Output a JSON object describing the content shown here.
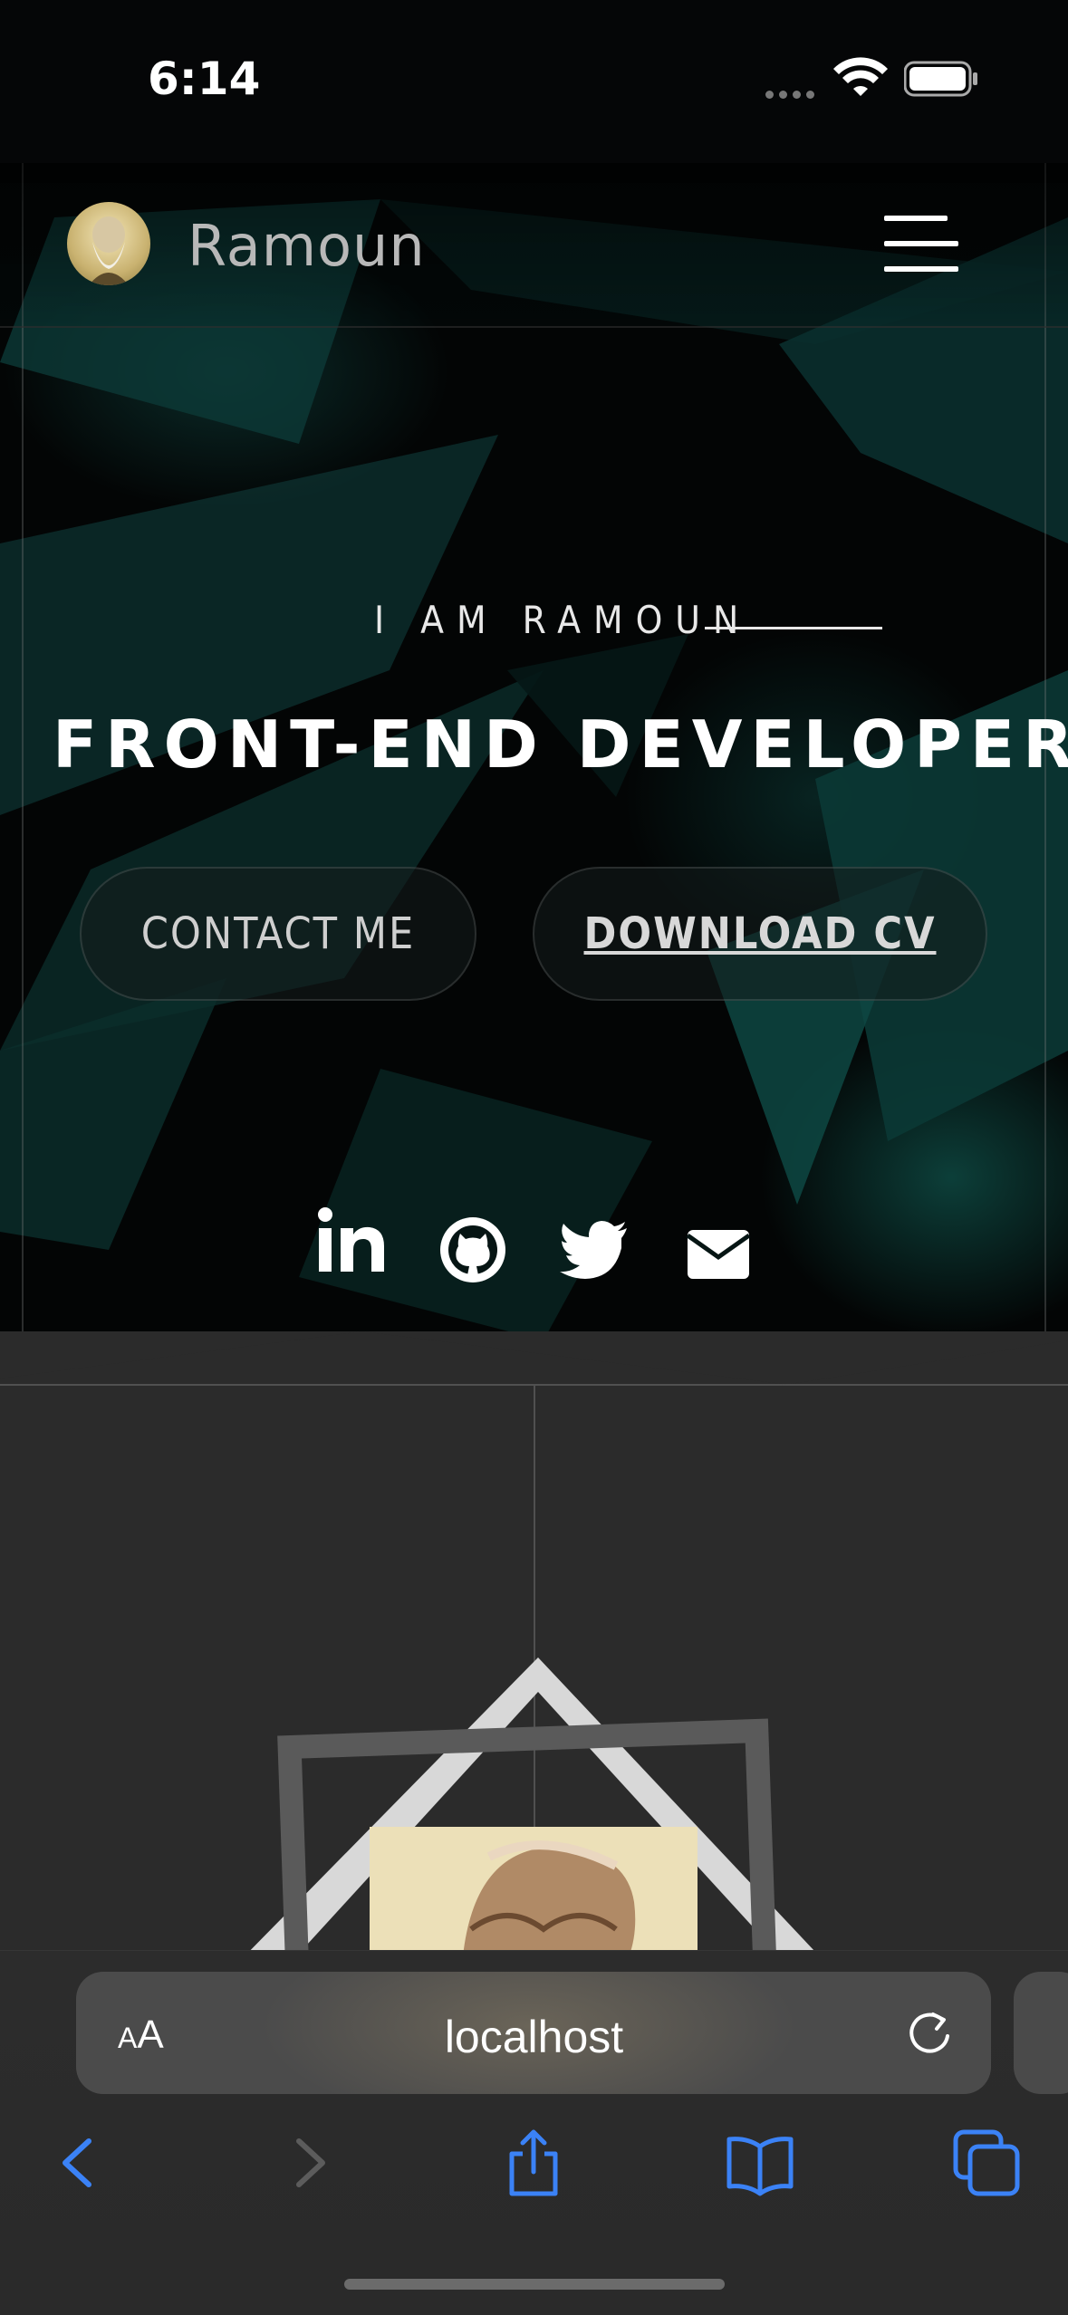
{
  "status_bar": {
    "time": "6:14"
  },
  "navbar": {
    "brand": "Ramoun",
    "avatar_icon": "portrait-avatar-icon",
    "menu_icon": "hamburger-menu-icon"
  },
  "hero": {
    "intro": "I AM RAMOUN",
    "headline": "FRONT-END DEVELOPER|",
    "contact_button": "CONTACT ME",
    "download_button": "DOWNLOAD CV",
    "social": [
      "linkedin-icon",
      "github-icon",
      "twitter-icon",
      "email-icon"
    ]
  },
  "browser": {
    "font_size_small": "A",
    "font_size_large": "A",
    "url": "localhost",
    "toolbar": [
      "back-icon",
      "forward-icon",
      "share-icon",
      "bookmarks-icon",
      "tabs-icon"
    ]
  },
  "colors": {
    "accent_teal": "#0e5a55",
    "browser_blue": "#3b82f6",
    "section_bg": "#2b2b2b"
  }
}
